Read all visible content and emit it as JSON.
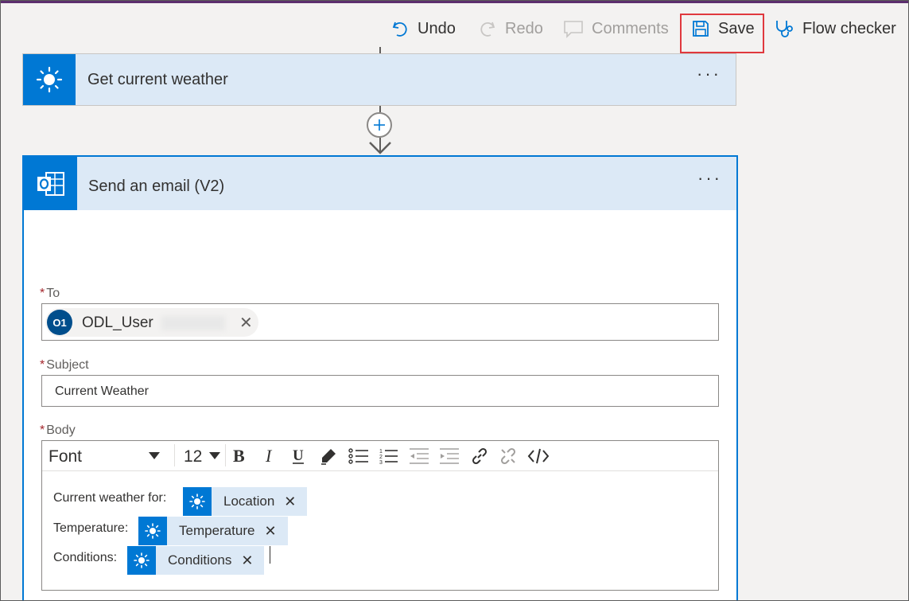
{
  "toolbar": {
    "undo_label": "Undo",
    "redo_label": "Redo",
    "comments_label": "Comments",
    "save_label": "Save",
    "flow_checker_label": "Flow checker"
  },
  "steps": [
    {
      "title": "Get current weather",
      "icon": "sun-icon",
      "more": "···"
    },
    {
      "title": "Send an email (V2)",
      "icon": "outlook-icon",
      "more": "···"
    }
  ],
  "email": {
    "to": {
      "label": "To",
      "required_mark": "*",
      "recipient": {
        "initials": "O1",
        "name": "ODL_User"
      }
    },
    "subject": {
      "label": "Subject",
      "required_mark": "*",
      "value": "Current Weather"
    },
    "body": {
      "label": "Body",
      "required_mark": "*",
      "editor": {
        "font": "Font",
        "size": "12",
        "buttons": [
          "bold",
          "italic",
          "underline",
          "highlight",
          "bulleted-list",
          "numbered-list",
          "decrease-indent",
          "increase-indent",
          "link",
          "unlink",
          "code-view"
        ]
      },
      "lines": [
        {
          "text": "Current weather for:",
          "token": "Location"
        },
        {
          "text": "Temperature:",
          "token": "Temperature"
        },
        {
          "text": "Conditions:",
          "token": "Conditions"
        }
      ]
    }
  },
  "colors": {
    "accent": "#0078d4",
    "card_header": "#dce9f6",
    "highlight_box": "#e0383e",
    "top_bar": "#5c2e6e"
  }
}
